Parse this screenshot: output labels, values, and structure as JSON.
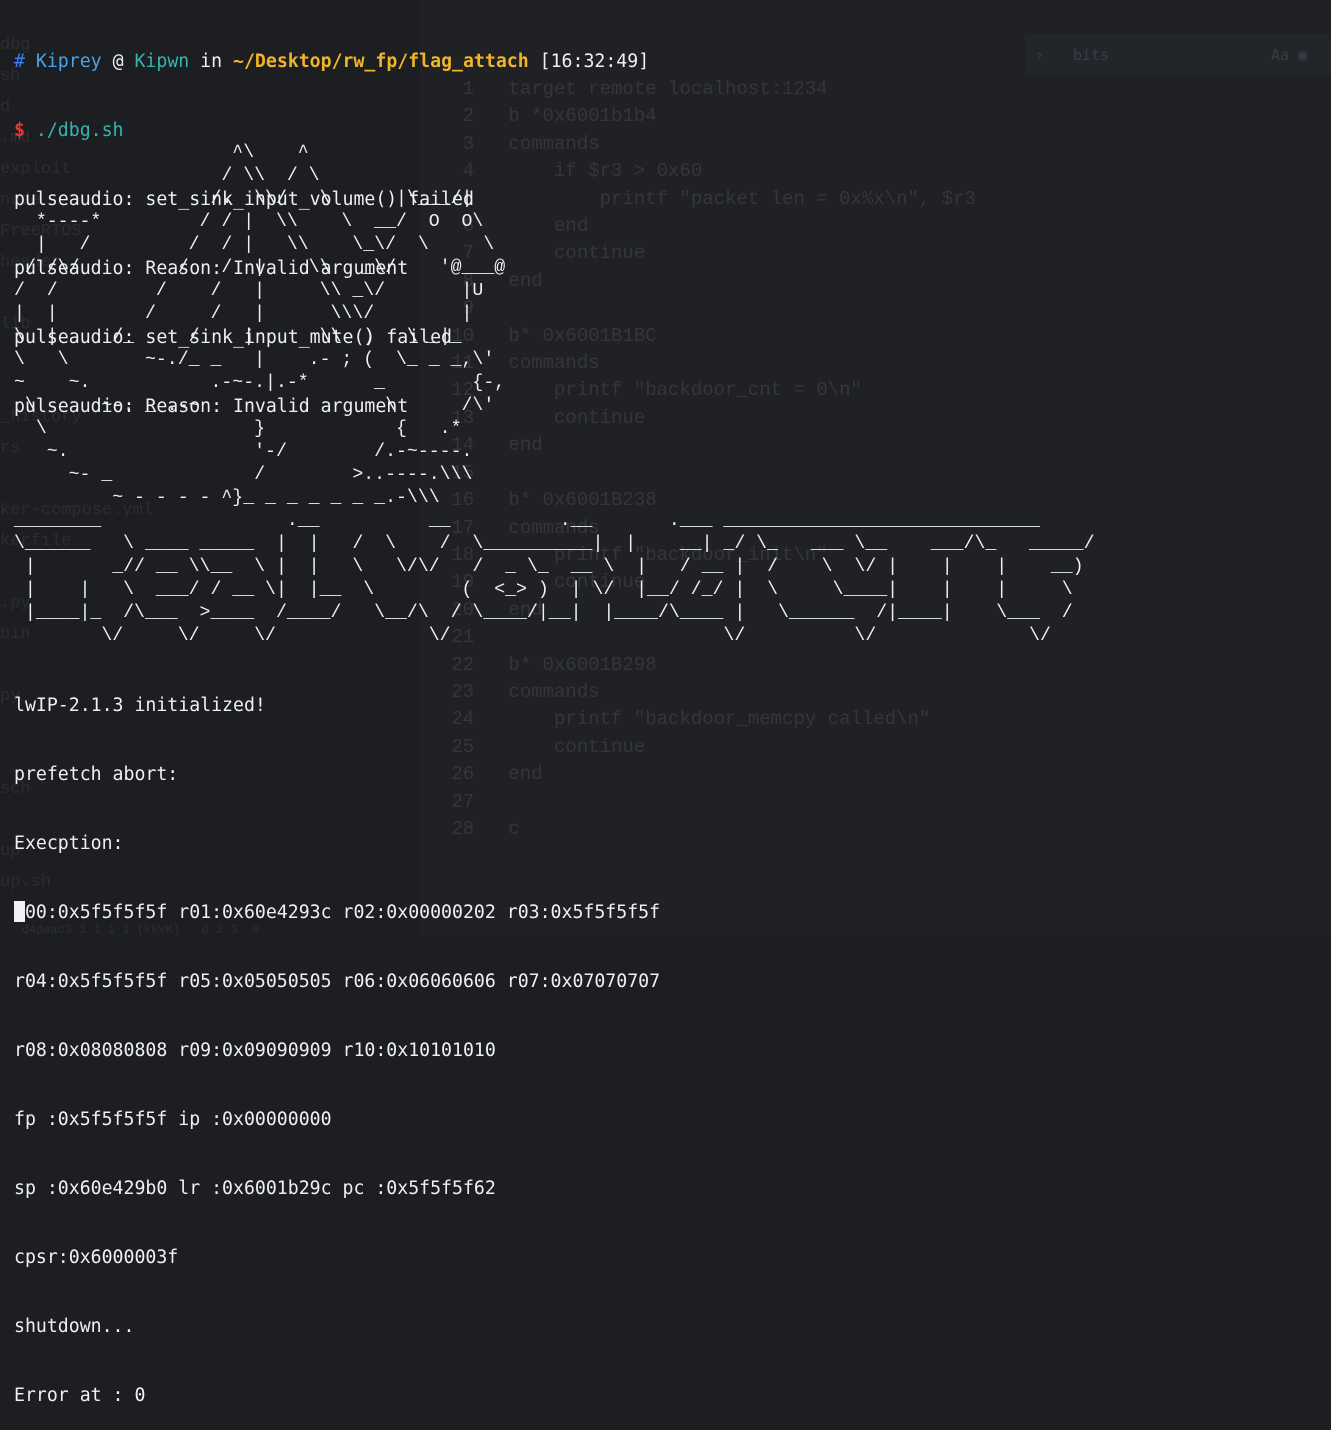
{
  "prompt": {
    "hash": "#",
    "user": "Kiprey",
    "at": "@",
    "host": "Kipwn",
    "in": "in",
    "path": "~/Desktop/rw_fp/flag_attach",
    "time": "[16:32:49]",
    "dollar": "$",
    "command": "./dbg.sh"
  },
  "output_head": [
    "pulseaudio: set_sink_input_volume() failed",
    "pulseaudio: Reason: Invalid argument",
    "pulseaudio: set_sink_input_mute() failed",
    "pulseaudio: Reason: Invalid argument"
  ],
  "ascii_art_ship": "                    ^\\    ^\n                   / \\\\  / \\\n                  /.  \\\\/   \\      |\\___/|\n  *----*         / / |  \\\\    \\  __/  O  O\\\n  |   /         /  / |   \\\\    \\_\\/  \\     \\\n / /\\/         /   /  |    \\\\   _\\/    '@___@\n/  /         /    /   |     \\\\ _\\/       |U\n|  |        /     /   |      \\\\\\/        |\n\\  |     /_     /    |      \\\\  )   \\ _|_\n\\   \\       ~-./_ _   |    .- ; (  \\_ _ _,\\'\n~    ~.           .-~-.|.-*      _        {-,\n \\      ~-. _ .-~                 \\      /\\'\n  \\                   }            {   .*\n   ~.                 '-/        /.-~----.\n     ~- _             /        >..----.\\\\\\\n         ~ - - - - ^}_ _ _ _ _ _ _.-\\\\\\",
  "ascii_art_banner": "________                 .__          __          .__       .___ _____________________________\n\\______   \\ ____ _____  |  |   /  \\    /  \\__________|  |    __| _/ \\_   ___ \\__    ___/\\_   _____/\n |       _// __ \\\\__  \\ |  |   \\   \\/\\/   /  _ \\_  __ \\  |   / __ |  /    \\  \\/ |    |    |    __)\n |    |   \\  ___/ / __ \\|  |__  \\        (  <_> )  | \\/  |__/ /_/ |  \\     \\____|    |    |     \\\n |____|_  /\\___  >____  /____/   \\__/\\  / \\____/|__|  |____/\\____ |   \\______  /|____|    \\___  /\n        \\/     \\/     \\/              \\/                         \\/          \\/              \\/",
  "output_tail": [
    "lwIP-2.1.3 initialized!",
    "prefetch abort:",
    "Execption:",
    "r00:0x5f5f5f5f r01:0x60e4293c r02:0x00000202 r03:0x5f5f5f5f",
    "r04:0x5f5f5f5f r05:0x05050505 r06:0x06060606 r07:0x07070707",
    "r08:0x08080808 r09:0x09090909 r10:0x10101010",
    "fp :0x5f5f5f5f ip :0x00000000",
    "sp :0x60e429b0 lr :0x6001b29c pc :0x5f5f5f62",
    "cpsr:0x6000003f",
    "shutdown...",
    "Error at : 0"
  ],
  "background_editor": {
    "search_box": "bits",
    "search_options": "Aa  ▣",
    "code": "  1   target remote localhost:1234\n  2   b *0x6001b1b4\n  3   commands\n  4       if $r3 > 0x60\n  5           printf \"packet len = 0x%x\\n\", $r3\n  6       end\n  7       continue\n  8   end\n  9\n 10   b* 0x6001B1BC\n 11   commands\n 12       printf \"backdoor_cnt = 0\\n\"\n 13       continue\n 14   end\n 15\n 16   b* 0x6001B238\n 17   commands\n 18       printf \"backdoor_init\\n\"\n 19       continue\n 20   end\n 21\n 22   b* 0x6001B298\n 23   commands\n 24       printf \"backdoor_memcpy called\\n\"\n 25       continue\n 26   end\n 27\n 28   c",
    "sidebar": "dbg\nsh\nd\n.md\nexploit\nnode\nFreeRTOS\nheader\n\nlib\n\n\n_history\nrs\n\nker-compose.yml\nkerfile\n\n.py\nbin\n\npy\n\n\nsch\n\nup\nup.sh",
    "status": "   d4deac3 1 1 1 1 (kkVK)   @ 2 3  0"
  }
}
